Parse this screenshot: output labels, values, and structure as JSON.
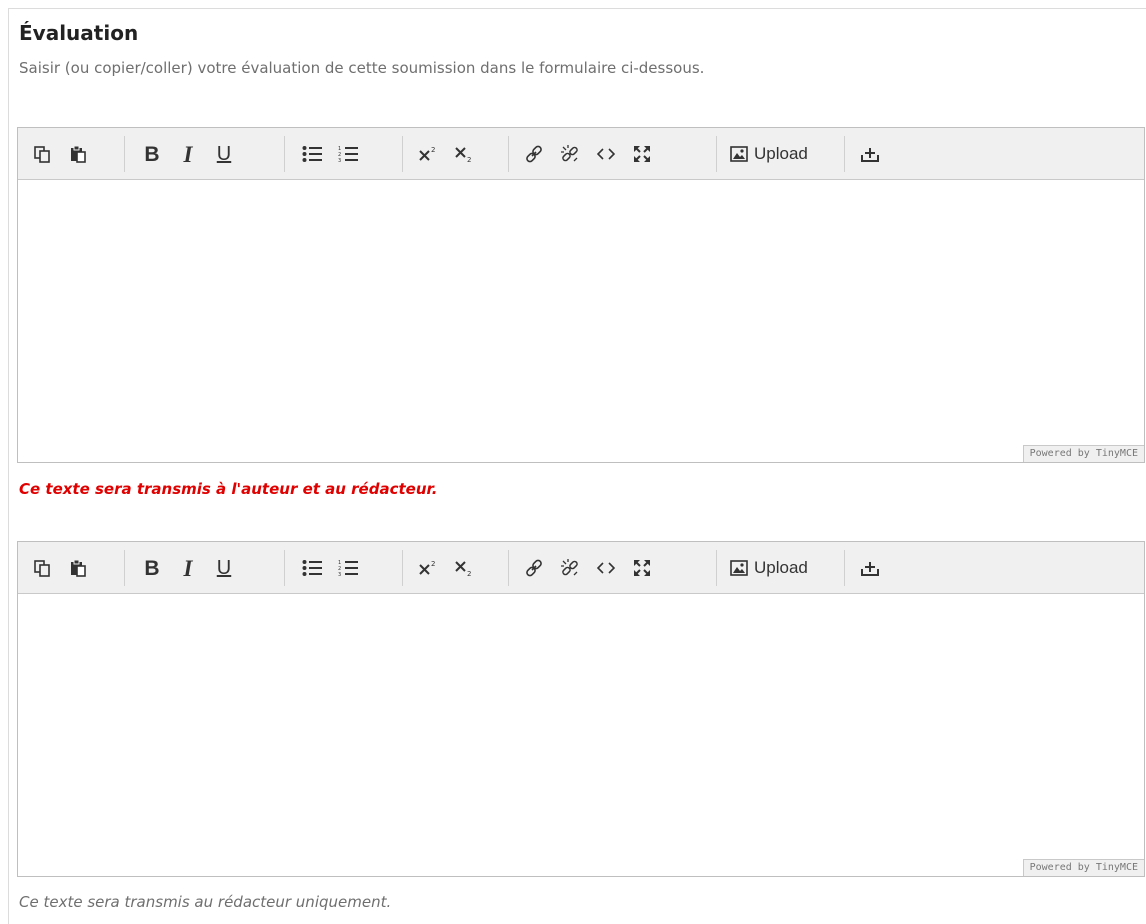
{
  "section": {
    "title": "Évaluation",
    "description": "Saisir (ou copier/coller) votre évaluation de cette soumission dans le formulaire ci-dessous."
  },
  "toolbar": {
    "upload_label": "Upload",
    "icons": [
      "copy-icon",
      "paste-icon",
      "bold-icon",
      "italic-icon",
      "underline-icon",
      "bullet-list-icon",
      "numbered-list-icon",
      "superscript-icon",
      "subscript-icon",
      "link-icon",
      "unlink-icon",
      "code-icon",
      "fullscreen-icon",
      "image-icon",
      "insert-icon"
    ],
    "bold_glyph": "B",
    "italic_glyph": "I",
    "underline_glyph": "U"
  },
  "editors": [
    {
      "powered": "Powered by TinyMCE",
      "note": "Ce texte sera transmis à l'auteur et au rédacteur."
    },
    {
      "powered": "Powered by TinyMCE",
      "note": "Ce texte sera transmis au rédacteur uniquement."
    }
  ],
  "colors": {
    "required_note": "#e00000",
    "info_note": "#6f6f6f",
    "toolbar_bg": "#f0f0f0"
  }
}
